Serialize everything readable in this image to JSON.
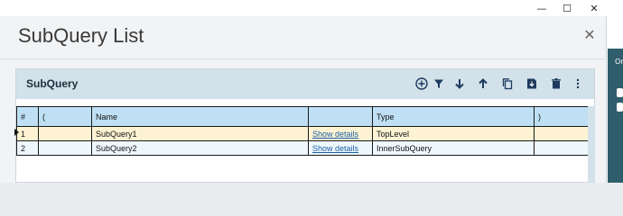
{
  "window": {
    "minimize_glyph": "—",
    "maximize_glyph": "☐",
    "close_glyph": "✕"
  },
  "background_app": {
    "partial_text": "Or"
  },
  "dialog": {
    "title": "SubQuery List",
    "close_glyph": "✕"
  },
  "panel": {
    "title": "SubQuery",
    "toolbar": [
      "add-circle-icon",
      "filter-icon",
      "arrow-down-icon",
      "arrow-up-icon",
      "copy-icon",
      "save-icon",
      "trash-icon",
      "more-vertical-icon"
    ]
  },
  "table": {
    "columns": [
      "#",
      "(",
      "Name",
      "",
      "Type",
      ")"
    ],
    "rows": [
      {
        "num": "1",
        "open": "",
        "name": "SubQuery1",
        "details": "Show details",
        "type": "TopLevel",
        "close": ""
      },
      {
        "num": "2",
        "open": "",
        "name": "SubQuery2",
        "details": "Show details",
        "type": "InnerSubQuery",
        "close": ""
      }
    ]
  },
  "colors": {
    "header_bg": "#d2e1ea",
    "column_header_bg": "#bfe0f4",
    "selected_row_bg": "#fdf3d3",
    "row_bg": "#eef8fc",
    "link": "#1a5fa8"
  }
}
